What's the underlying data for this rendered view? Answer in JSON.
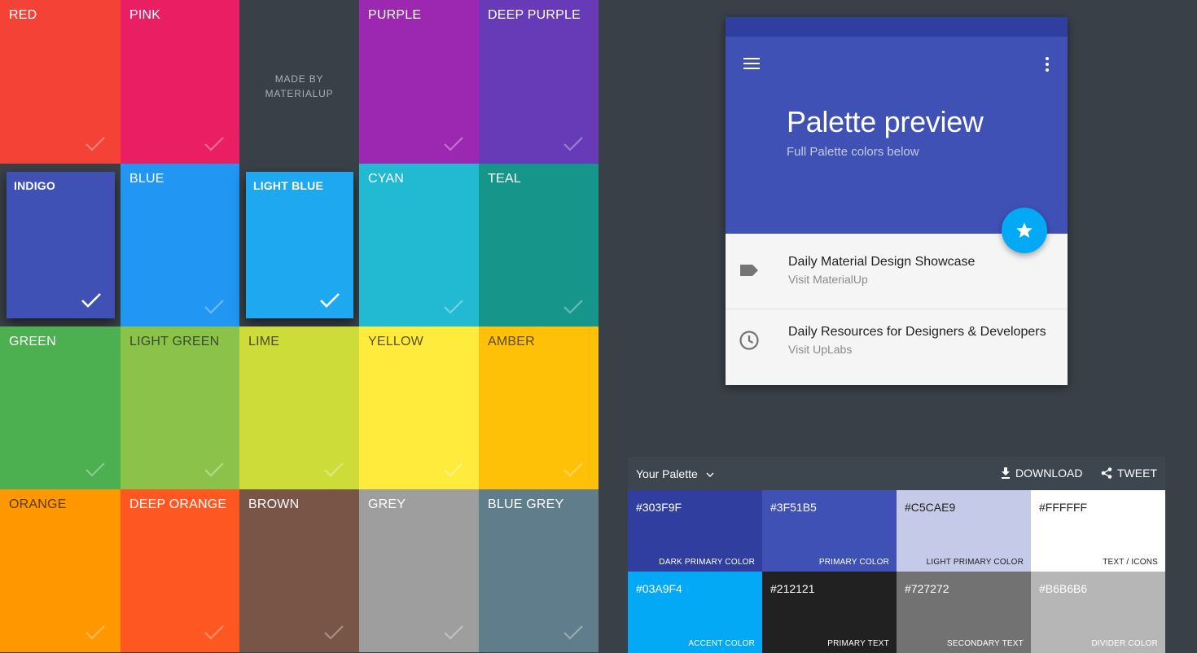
{
  "grid": {
    "tiles": [
      {
        "name": "RED",
        "color": "#F44336",
        "text": "#ffffff",
        "selected": false
      },
      {
        "name": "PINK",
        "color": "#E91E63",
        "text": "#ffffff",
        "selected": false
      },
      null,
      {
        "name": "PURPLE",
        "color": "#9C27B0",
        "text": "#ffffff",
        "selected": false
      },
      {
        "name": "DEEP PURPLE",
        "color": "#673AB7",
        "text": "#ffffff",
        "selected": false
      },
      {
        "name": "INDIGO",
        "color": "#3F51B5",
        "text": "#ffffff",
        "selected": true
      },
      {
        "name": "BLUE",
        "color": "#2196F3",
        "text": "#ffffff",
        "selected": false
      },
      {
        "name": "LIGHT BLUE",
        "color": "#1EA8F0",
        "text": "#ffffff",
        "selected": true
      },
      {
        "name": "CYAN",
        "color": "#22BAD3",
        "text": "#ffffff",
        "selected": false
      },
      {
        "name": "TEAL",
        "color": "#16968A",
        "text": "#ffffff",
        "selected": false
      },
      {
        "name": "GREEN",
        "color": "#4CAF50",
        "text": "#ffffff",
        "selected": false
      },
      {
        "name": "LIGHT GREEN",
        "color": "#8BC34A",
        "text": "#3b4a2a",
        "selected": false
      },
      {
        "name": "LIME",
        "color": "#CDDC39",
        "text": "#4c4c1e",
        "selected": false
      },
      {
        "name": "YELLOW",
        "color": "#FFEB3B",
        "text": "#5a5420",
        "selected": false
      },
      {
        "name": "AMBER",
        "color": "#FFC107",
        "text": "#5a4a1c",
        "selected": false
      },
      {
        "name": "ORANGE",
        "color": "#FF9800",
        "text": "#5a3a1a",
        "selected": false
      },
      {
        "name": "DEEP ORANGE",
        "color": "#FF5722",
        "text": "#ffffff",
        "selected": false
      },
      {
        "name": "BROWN",
        "color": "#795548",
        "text": "#ffffff",
        "selected": false
      },
      {
        "name": "GREY",
        "color": "#9E9E9E",
        "text": "#ffffff",
        "selected": false
      },
      {
        "name": "BLUE GREY",
        "color": "#607D8B",
        "text": "#ffffff",
        "selected": false
      }
    ],
    "made_by_line1": "MADE BY",
    "made_by_line2": "MATERIALUP"
  },
  "preview": {
    "title": "Palette preview",
    "subtitle": "Full Palette colors below",
    "items": [
      {
        "icon": "label-icon",
        "primary": "Daily Material Design Showcase",
        "secondary": "Visit MaterialUp"
      },
      {
        "icon": "clock-icon",
        "primary": "Daily Resources for Designers & Developers",
        "secondary": "Visit UpLabs"
      }
    ]
  },
  "palette": {
    "title": "Your Palette",
    "download_label": "DOWNLOAD",
    "tweet_label": "TWEET",
    "swatches": [
      {
        "hex": "#303F9F",
        "role": "DARK PRIMARY COLOR",
        "text": "#ffffff"
      },
      {
        "hex": "#3F51B5",
        "role": "PRIMARY COLOR",
        "text": "#ffffff"
      },
      {
        "hex": "#C5CAE9",
        "role": "LIGHT PRIMARY COLOR",
        "text": "#212121"
      },
      {
        "hex": "#FFFFFF",
        "role": "TEXT / ICONS",
        "text": "#212121"
      },
      {
        "hex": "#03A9F4",
        "role": "ACCENT COLOR",
        "text": "#ffffff"
      },
      {
        "hex": "#212121",
        "role": "PRIMARY TEXT",
        "text": "#ffffff"
      },
      {
        "hex": "#727272",
        "role": "SECONDARY TEXT",
        "text": "#ffffff"
      },
      {
        "hex": "#B6B6B6",
        "role": "DIVIDER COLOR",
        "text": "#ffffff"
      }
    ]
  }
}
